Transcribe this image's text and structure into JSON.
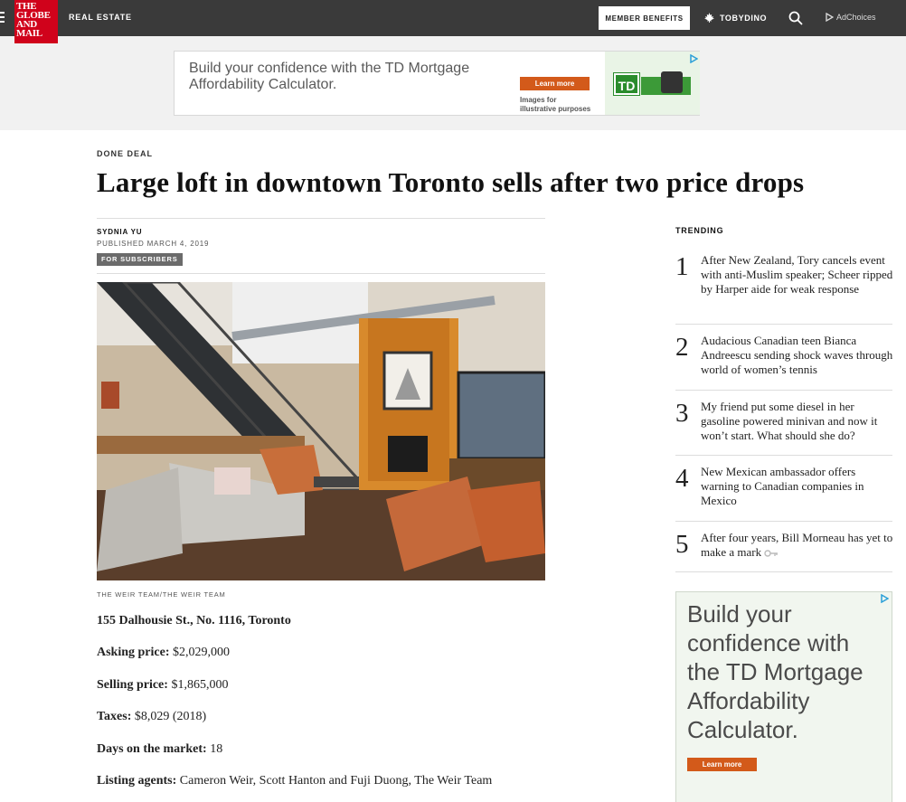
{
  "header": {
    "logo_lines": [
      "THE",
      "GLOBE",
      "AND",
      "MAIL"
    ],
    "section": "REAL ESTATE",
    "member_benefits": "MEMBER BENEFITS",
    "username": "TOBYDINO",
    "adchoices": "AdChoices"
  },
  "top_ad": {
    "text": "Build your confidence with the TD Mortgage Affordability Calculator.",
    "button": "Learn more",
    "note_line1": "Images for",
    "note_line2": "illustrative purposes",
    "brand": "TD"
  },
  "article": {
    "kicker": "DONE DEAL",
    "headline": "Large loft in downtown Toronto sells after two price drops",
    "author": "SYDNIA YU",
    "published": "PUBLISHED MARCH 4, 2019",
    "badge": "FOR SUBSCRIBERS",
    "photo_credit": "THE WEIR TEAM/THE WEIR TEAM",
    "address": "155 Dalhousie St., No. 1116, Toronto",
    "details": [
      {
        "label": "Asking price:",
        "value": "$2,029,000"
      },
      {
        "label": "Selling price:",
        "value": "$1,865,000"
      },
      {
        "label": "Taxes:",
        "value": "$8,029 (2018)"
      },
      {
        "label": "Days on the market:",
        "value": "18"
      },
      {
        "label": "Listing agents:",
        "value": "Cameron Weir, Scott Hanton and Fuji Duong, The Weir Team"
      }
    ]
  },
  "trending": {
    "title": "TRENDING",
    "items": [
      {
        "num": "1",
        "text": "After New Zealand, Tory cancels event with anti-Muslim speaker; Scheer ripped by Harper aide for weak response"
      },
      {
        "num": "2",
        "text": "Audacious Canadian teen Bianca Andreescu sending shock waves through world of women’s tennis"
      },
      {
        "num": "3",
        "text": "My friend put some diesel in her gasoline powered minivan and now it won’t start. What should she do?"
      },
      {
        "num": "4",
        "text": "New Mexican ambassador offers warning to Canadian companies in Mexico"
      },
      {
        "num": "5",
        "text": "After four years, Bill Morneau has yet to make a mark"
      }
    ]
  },
  "side_ad": {
    "text": "Build your confidence with the TD Mortgage Affordability Calculator.",
    "button": "Learn more"
  },
  "colors": {
    "topbar": "#3a3a3a",
    "logo_red": "#d0021b",
    "ad_orange": "#d35a1a",
    "td_green": "#2a8c2c"
  }
}
